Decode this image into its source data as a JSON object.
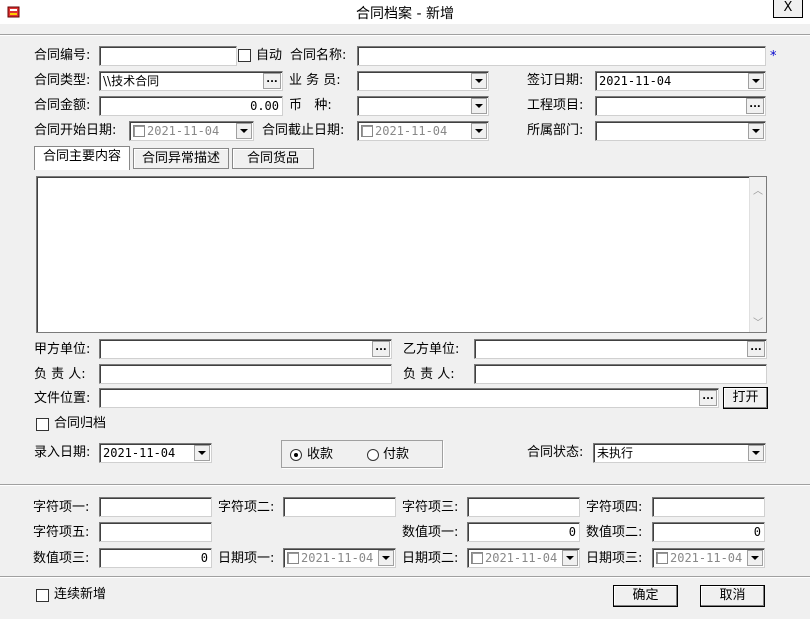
{
  "window": {
    "title": "合同档案 - 新增",
    "close": "X"
  },
  "fields": {
    "contract_no": {
      "label": "合同编号:",
      "value": ""
    },
    "auto": {
      "label": "自动"
    },
    "contract_name": {
      "label": "合同名称:",
      "value": "",
      "required_mark": "*"
    },
    "contract_type": {
      "label": "合同类型:",
      "value": "\\\\技术合同"
    },
    "salesman": {
      "label": "业 务 员:",
      "value": ""
    },
    "sign_date": {
      "label": "签订日期:",
      "value": "2021-11-04"
    },
    "amount": {
      "label": "合同金额:",
      "value": "0.00"
    },
    "currency": {
      "label": "币   种:",
      "value": ""
    },
    "project": {
      "label": "工程项目:",
      "value": ""
    },
    "start_date": {
      "label": "合同开始日期:",
      "value": "2021-11-04"
    },
    "end_date": {
      "label": "合同截止日期:",
      "value": "2021-11-04"
    },
    "department": {
      "label": "所属部门:",
      "value": ""
    }
  },
  "tabs": [
    "合同主要内容",
    "合同异常描述",
    "合同货品"
  ],
  "parties": {
    "party_a": {
      "label": "甲方单位:",
      "value": ""
    },
    "party_b": {
      "label": "乙方单位:",
      "value": ""
    },
    "resp_a": {
      "label": "负 责 人:",
      "value": ""
    },
    "resp_b": {
      "label": "负 责 人:",
      "value": ""
    },
    "file_location": {
      "label": "文件位置:",
      "value": "",
      "open_label": "打开"
    }
  },
  "archive": {
    "label": "合同归档"
  },
  "entry_date": {
    "label": "录入日期:",
    "value": "2021-11-04"
  },
  "payment": {
    "receive": "收款",
    "pay": "付款"
  },
  "status": {
    "label": "合同状态:",
    "value": "未执行"
  },
  "custom": {
    "str1": {
      "label": "字符项一:",
      "value": ""
    },
    "str2": {
      "label": "字符项二:",
      "value": ""
    },
    "str3": {
      "label": "字符项三:",
      "value": ""
    },
    "str4": {
      "label": "字符项四:",
      "value": ""
    },
    "str5": {
      "label": "字符项五:",
      "value": ""
    },
    "num1": {
      "label": "数值项一:",
      "value": "0"
    },
    "num2": {
      "label": "数值项二:",
      "value": "0"
    },
    "num3": {
      "label": "数值项三:",
      "value": "0"
    },
    "date1": {
      "label": "日期项一:",
      "value": "2021-11-04"
    },
    "date2": {
      "label": "日期项二:",
      "value": "2021-11-04"
    },
    "date3": {
      "label": "日期项三:",
      "value": "2021-11-04"
    }
  },
  "footer": {
    "continuous": "连续新增",
    "ok": "确定",
    "cancel": "取消"
  }
}
